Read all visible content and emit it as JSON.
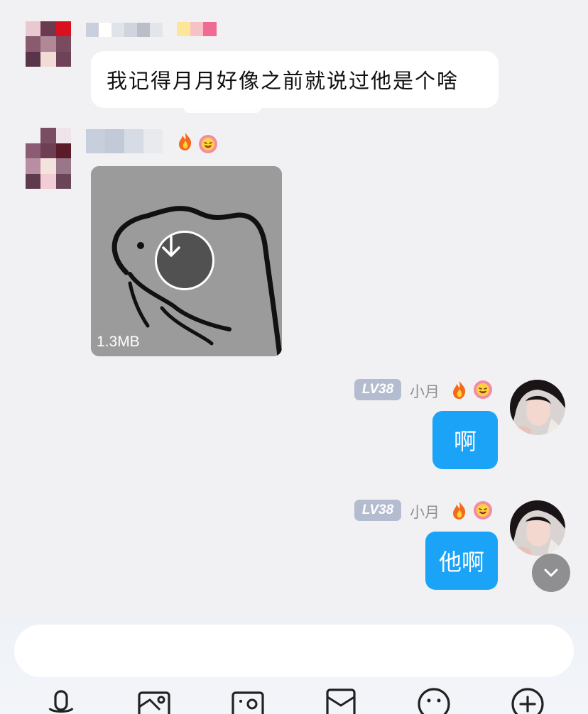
{
  "messages": {
    "first": {
      "text": "我记得月月好像之前就说过他是个啥"
    },
    "second": {
      "file_size": "1.3MB"
    },
    "third": {
      "level": "LV38",
      "nickname": "小月",
      "text": "啊"
    },
    "fourth": {
      "level": "LV38",
      "nickname": "小月",
      "text": "他啊"
    }
  },
  "icons": {
    "fire": "fire-icon",
    "smile_flower": "smile-flower-icon",
    "download": "download-icon",
    "scroll_down": "chevron-down-icon",
    "toolbar": [
      "microphone-icon",
      "image-icon",
      "camera-icon",
      "red-envelope-icon",
      "emoji-icon",
      "plus-icon"
    ]
  },
  "colors": {
    "background": "#f1f1f3",
    "bubble_self": "#1aa3f7",
    "level_badge": "#b4bcd0"
  }
}
